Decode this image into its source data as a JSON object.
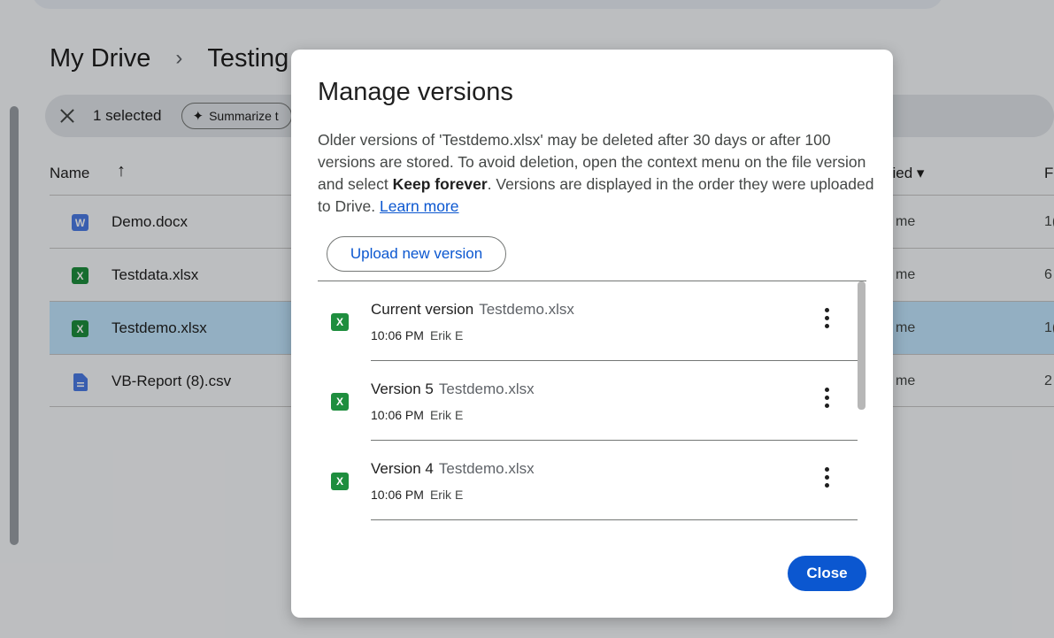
{
  "background": {
    "breadcrumb": [
      "My Drive",
      "Testing"
    ],
    "breadcrumb_separator": "›",
    "selection": {
      "count_label": "1 selected",
      "summarize_label": "Summarize t"
    },
    "columns": {
      "name": "Name",
      "sort_arrow": "↑",
      "modified": "ified ▾",
      "size": "F"
    },
    "files": [
      {
        "name": "Demo.docx",
        "type": "word",
        "icon": "W",
        "owner": "me",
        "size": "1("
      },
      {
        "name": "Testdata.xlsx",
        "type": "excel",
        "icon": "X",
        "owner": "me",
        "size": "6"
      },
      {
        "name": "Testdemo.xlsx",
        "type": "excel",
        "icon": "X",
        "owner": "me",
        "size": "1(",
        "selected": true
      },
      {
        "name": "VB-Report (8).csv",
        "type": "doc",
        "icon": "doc-icon",
        "owner": "me",
        "size": "2"
      }
    ]
  },
  "dialog": {
    "title": "Manage versions",
    "desc_part1": "Older versions of 'Testdemo.xlsx' may be deleted after 30 days or after 100 versions are stored. To avoid deletion, open the context menu on the file version and select ",
    "desc_bold": "Keep forever",
    "desc_part2": ". Versions are displayed in the order they were uploaded to Drive. ",
    "learn_more": "Learn more",
    "upload_label": "Upload new version",
    "versions": [
      {
        "label": "Current version",
        "file": "Testdemo.xlsx",
        "time": "10:06 PM",
        "user": "Erik E"
      },
      {
        "label": "Version 5",
        "file": "Testdemo.xlsx",
        "time": "10:06 PM",
        "user": "Erik E"
      },
      {
        "label": "Version 4",
        "file": "Testdemo.xlsx",
        "time": "10:06 PM",
        "user": "Erik E"
      }
    ],
    "close_label": "Close"
  },
  "colors": {
    "accent": "#0b57d0",
    "selected_row": "#c2e7ff",
    "excel": "#1e8e3e",
    "word": "#4b7ce6"
  }
}
